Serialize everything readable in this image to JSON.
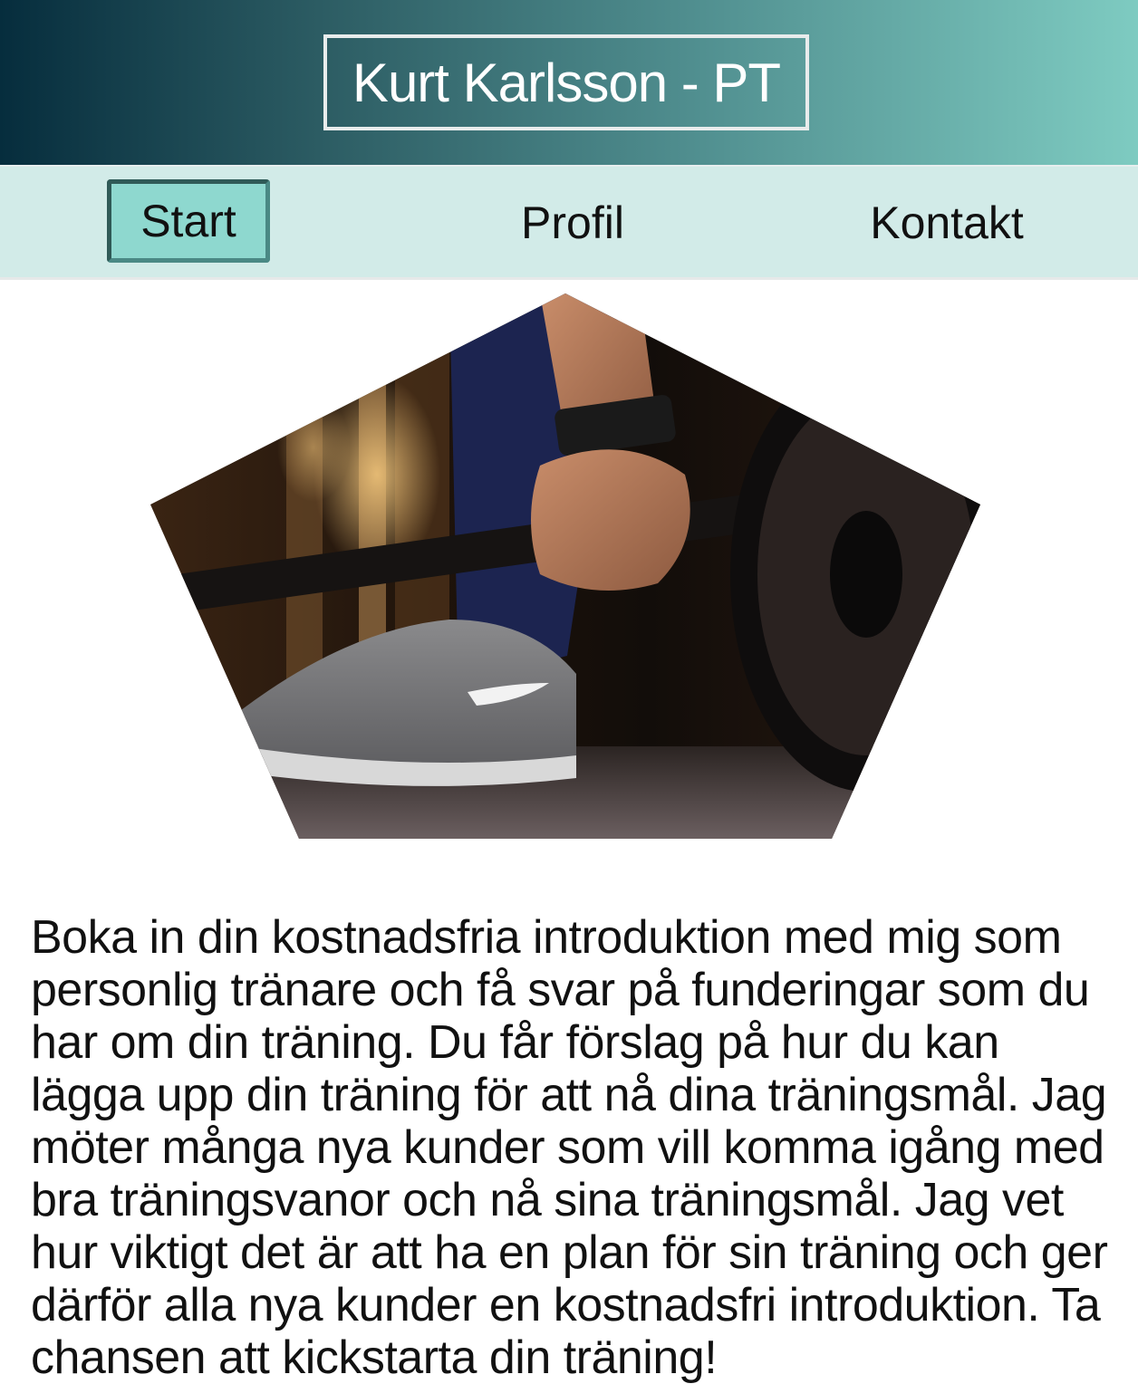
{
  "header": {
    "title": "Kurt Karlsson - PT"
  },
  "nav": {
    "items": [
      {
        "label": "Start",
        "active": true
      },
      {
        "label": "Profil",
        "active": false
      },
      {
        "label": "Kontakt",
        "active": false
      }
    ]
  },
  "hero": {
    "image": "deadlift-barbell-sneaker-photo",
    "shape": "pentagon"
  },
  "main": {
    "intro": "Boka in din kostnadsfria introduktion med mig som personlig tränare och få svar på funderingar som du har om din träning. Du får förslag på hur du kan lägga upp din träning för att nå dina träningsmål. Jag möter många nya kunder som vill komma igång med bra träningsvanor och nå sina träningsmål. Jag vet hur viktigt det är att ha en plan för sin träning och ger därför alla nya kunder en kostnadsfri introduktion. Ta chansen att kickstarta din träning!"
  },
  "colors": {
    "header_gradient_start": "#062d3d",
    "header_gradient_end": "#7ecbc1",
    "nav_background": "#d2ebe8",
    "active_tab": "#8ed8cf",
    "active_tab_border": "#2f5a57"
  }
}
